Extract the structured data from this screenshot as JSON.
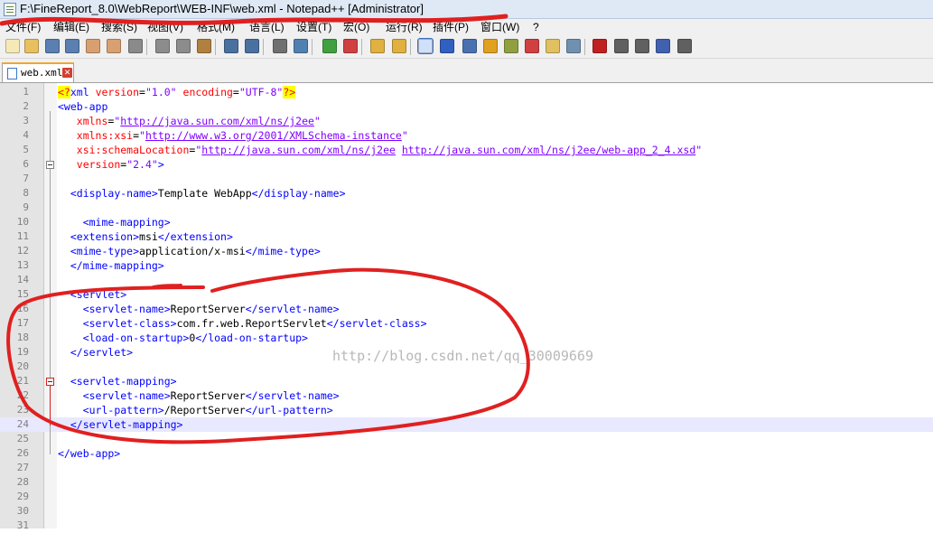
{
  "window": {
    "title": "F:\\FineReport_8.0\\WebReport\\WEB-INF\\web.xml - Notepad++ [Administrator]"
  },
  "menu": [
    {
      "label": "文件(F)"
    },
    {
      "label": "编辑(E)"
    },
    {
      "label": "搜索(S)"
    },
    {
      "label": "视图(V)"
    },
    {
      "label": "格式(M)"
    },
    {
      "label": "语言(L)"
    },
    {
      "label": "设置(T)"
    },
    {
      "label": "宏(O)"
    },
    {
      "label": "运行(R)"
    },
    {
      "label": "插件(P)"
    },
    {
      "label": "窗口(W)"
    },
    {
      "label": "?"
    }
  ],
  "toolbar_icons": [
    "new-icon",
    "open-icon",
    "save-icon",
    "save-all-icon",
    "close-icon",
    "close-all-icon",
    "print-icon",
    "cut-icon",
    "copy-icon",
    "paste-icon",
    "undo-icon",
    "redo-icon",
    "find-icon",
    "replace-icon",
    "zoom-in-icon",
    "zoom-out-icon",
    "sync-vertical-icon",
    "sync-horizontal-icon",
    "word-wrap-icon",
    "show-all-chars-icon",
    "indent-guide-icon",
    "user-lang-icon",
    "doc-map-icon",
    "function-list-icon",
    "folder-icon",
    "monitor-icon",
    "record-macro-icon",
    "stop-macro-icon",
    "play-macro-icon",
    "run-macro-multiple-icon",
    "save-macro-icon"
  ],
  "tab": {
    "label": "web.xml",
    "close_icon": "close-tab-icon"
  },
  "watermark": "http://blog.csdn.net/qq_30009669",
  "colors": {
    "tag": "#0000ff",
    "attr": "#ff0000",
    "value": "#8000ff",
    "current_line": "#e8e8ff",
    "annotation": "#e02020"
  },
  "lines": [
    [
      [
        "p",
        "<?"
      ],
      [
        "t",
        "xml "
      ],
      [
        "a",
        "version"
      ],
      [
        "x",
        "="
      ],
      [
        "v",
        "\"1.0\""
      ],
      [
        "x",
        " "
      ],
      [
        "a",
        "encoding"
      ],
      [
        "x",
        "="
      ],
      [
        "v",
        "\"UTF-8\""
      ],
      [
        "p",
        "?>"
      ]
    ],
    [
      [
        "t",
        "<web-app"
      ]
    ],
    [
      [
        "x",
        "   "
      ],
      [
        "a",
        "xmlns"
      ],
      [
        "x",
        "="
      ],
      [
        "v",
        "\""
      ],
      [
        "u",
        "http://java.sun.com/xml/ns/j2ee"
      ],
      [
        "v",
        "\""
      ]
    ],
    [
      [
        "x",
        "   "
      ],
      [
        "a",
        "xmlns:xsi"
      ],
      [
        "x",
        "="
      ],
      [
        "v",
        "\""
      ],
      [
        "u",
        "http://www.w3.org/2001/XMLSchema-instance"
      ],
      [
        "v",
        "\""
      ]
    ],
    [
      [
        "x",
        "   "
      ],
      [
        "a",
        "xsi:schemaLocation"
      ],
      [
        "x",
        "="
      ],
      [
        "v",
        "\""
      ],
      [
        "u",
        "http://java.sun.com/xml/ns/j2ee"
      ],
      [
        "x",
        " "
      ],
      [
        "u",
        "http://java.sun.com/xml/ns/j2ee/web-app_2_4.xsd"
      ],
      [
        "v",
        "\""
      ]
    ],
    [
      [
        "x",
        "   "
      ],
      [
        "a",
        "version"
      ],
      [
        "x",
        "="
      ],
      [
        "v",
        "\"2.4\""
      ],
      [
        "t",
        ">"
      ]
    ],
    [],
    [
      [
        "x",
        "  "
      ],
      [
        "t",
        "<display-name>"
      ],
      [
        "x",
        "Template WebApp"
      ],
      [
        "t",
        "</display-name>"
      ]
    ],
    [],
    [
      [
        "x",
        "    "
      ],
      [
        "t",
        "<mime-mapping>"
      ]
    ],
    [
      [
        "x",
        "  "
      ],
      [
        "t",
        "<extension>"
      ],
      [
        "x",
        "msi"
      ],
      [
        "t",
        "</extension>"
      ]
    ],
    [
      [
        "x",
        "  "
      ],
      [
        "t",
        "<mime-type>"
      ],
      [
        "x",
        "application/x-msi"
      ],
      [
        "t",
        "</mime-type>"
      ]
    ],
    [
      [
        "x",
        "  "
      ],
      [
        "t",
        "</mime-mapping>"
      ]
    ],
    [],
    [
      [
        "x",
        "  "
      ],
      [
        "t",
        "<servlet>"
      ]
    ],
    [
      [
        "x",
        "    "
      ],
      [
        "t",
        "<servlet-name>"
      ],
      [
        "x",
        "ReportServer"
      ],
      [
        "t",
        "</servlet-name>"
      ]
    ],
    [
      [
        "x",
        "    "
      ],
      [
        "t",
        "<servlet-class>"
      ],
      [
        "x",
        "com.fr.web.ReportServlet"
      ],
      [
        "t",
        "</servlet-class>"
      ]
    ],
    [
      [
        "x",
        "    "
      ],
      [
        "t",
        "<load-on-startup>"
      ],
      [
        "x",
        "0"
      ],
      [
        "t",
        "</load-on-startup>"
      ]
    ],
    [
      [
        "x",
        "  "
      ],
      [
        "t",
        "</servlet>"
      ]
    ],
    [],
    [
      [
        "x",
        "  "
      ],
      [
        "t",
        "<servlet-mapping>"
      ]
    ],
    [
      [
        "x",
        "    "
      ],
      [
        "t",
        "<servlet-name>"
      ],
      [
        "x",
        "ReportServer"
      ],
      [
        "t",
        "</servlet-name>"
      ]
    ],
    [
      [
        "x",
        "    "
      ],
      [
        "t",
        "<url-pattern>"
      ],
      [
        "x",
        "/ReportServer"
      ],
      [
        "t",
        "</url-pattern>"
      ]
    ],
    [
      [
        "x",
        "  "
      ],
      [
        "t",
        "</servlet-mapping>"
      ]
    ],
    [],
    [
      [
        "t",
        "</web-app>"
      ]
    ],
    [],
    [],
    [],
    [],
    []
  ],
  "line_numbers": [
    "1",
    "2",
    "3",
    "4",
    "5",
    "6",
    "7",
    "8",
    "9",
    "10",
    "11",
    "12",
    "13",
    "14",
    "15",
    "16",
    "17",
    "18",
    "19",
    "20",
    "21",
    "22",
    "23",
    "24",
    "25",
    "26",
    "27",
    "28",
    "29",
    "30",
    "31"
  ],
  "current_line": 24
}
